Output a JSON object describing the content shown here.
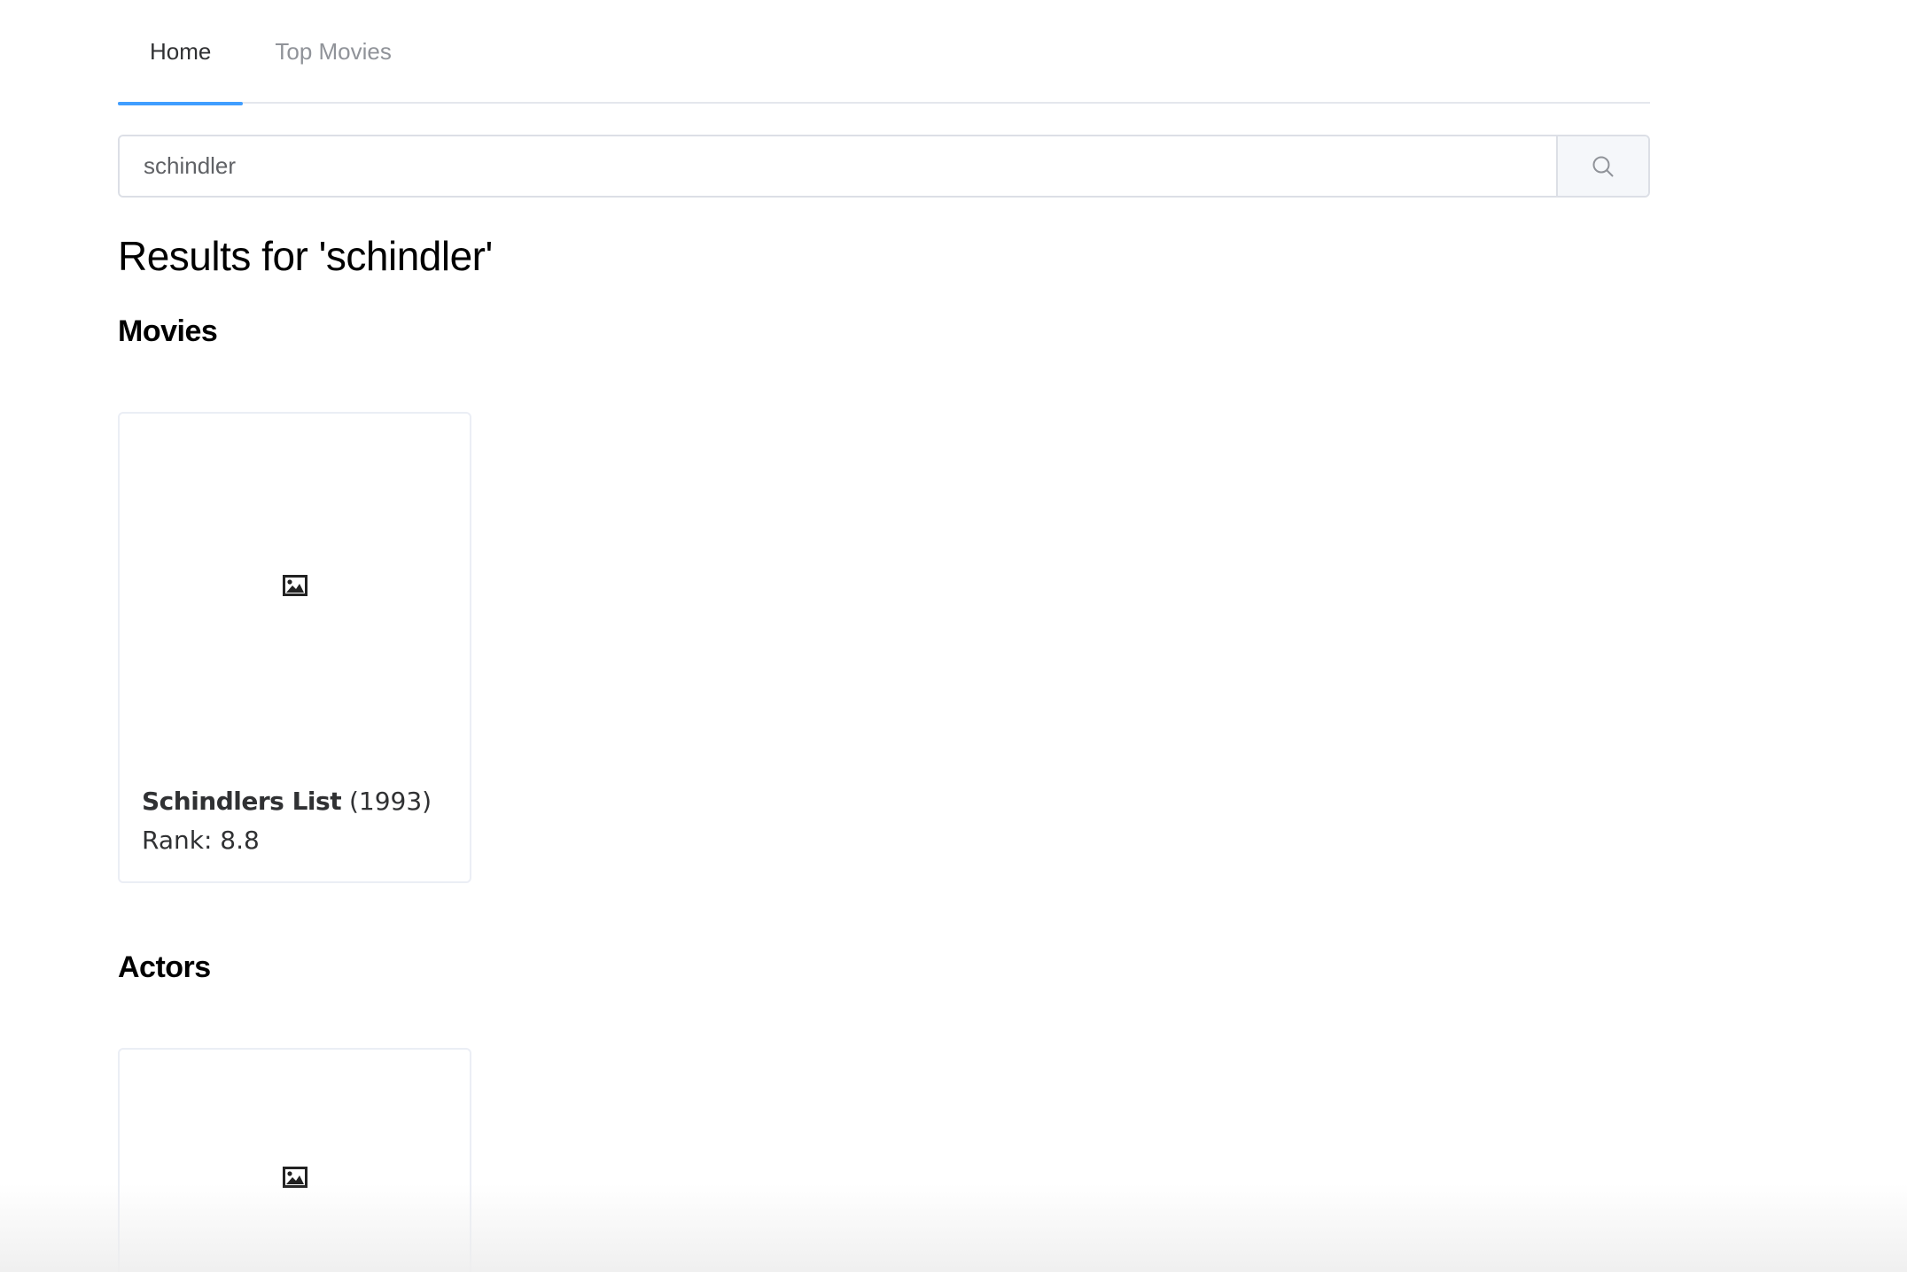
{
  "tabs": [
    {
      "label": "Home",
      "active": true
    },
    {
      "label": "Top Movies",
      "active": false
    }
  ],
  "search": {
    "value": "schindler",
    "button_icon": "search-icon"
  },
  "results_title": "Results for 'schindler'",
  "sections": {
    "movies": {
      "title": "Movies",
      "items": [
        {
          "name": "Schindlers List",
          "year": "(1993)",
          "rank": "Rank: 8.8",
          "image_icon": "image-placeholder-icon"
        }
      ]
    },
    "actors": {
      "title": "Actors",
      "items": [
        {
          "image_icon": "image-placeholder-icon"
        }
      ]
    }
  },
  "colors": {
    "accent": "#409eff",
    "tab_inactive": "#909399",
    "border": "#dcdfe6"
  }
}
